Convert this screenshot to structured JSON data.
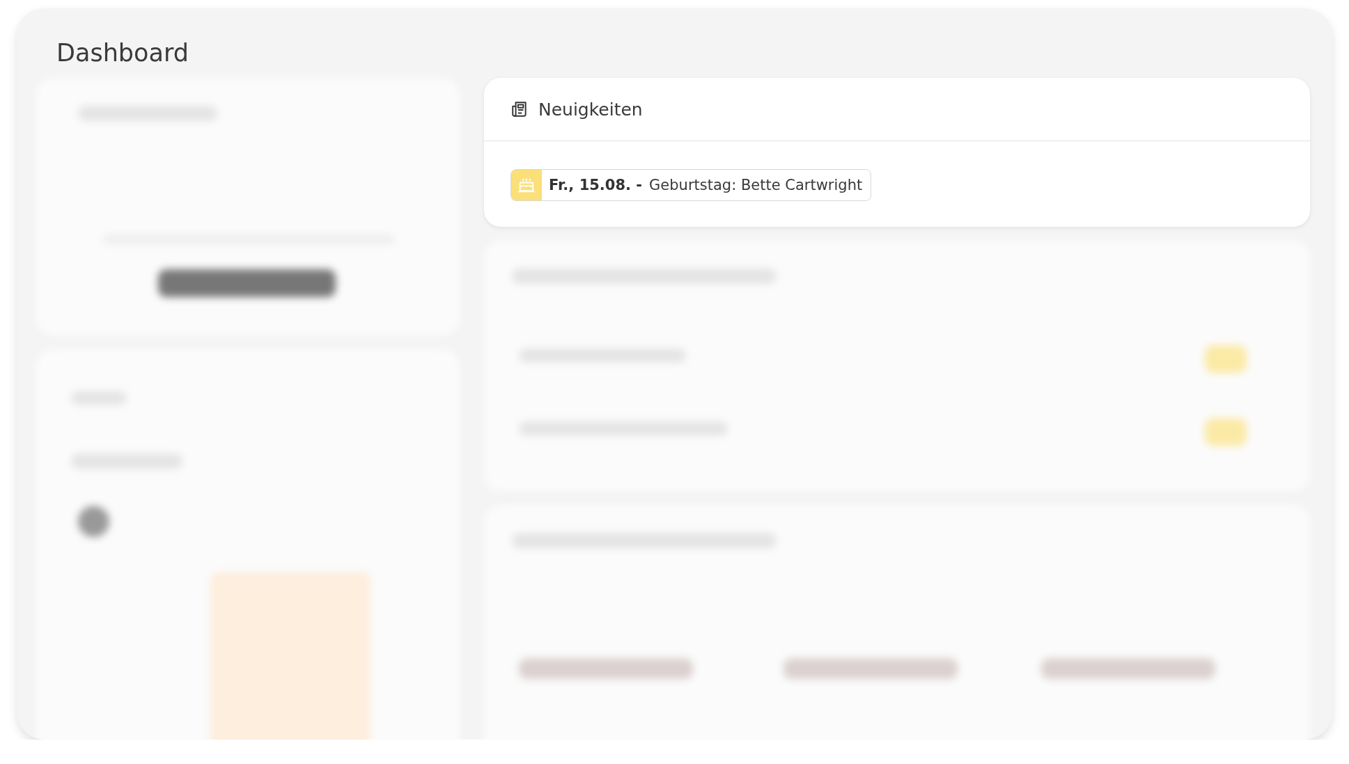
{
  "page": {
    "title": "Dashboard"
  },
  "news": {
    "title": "Neuigkeiten",
    "items": [
      {
        "kind": "birthday",
        "date": "Fr., 15.08. -",
        "text": "Geburtstag: Bette Cartwright"
      }
    ]
  }
}
